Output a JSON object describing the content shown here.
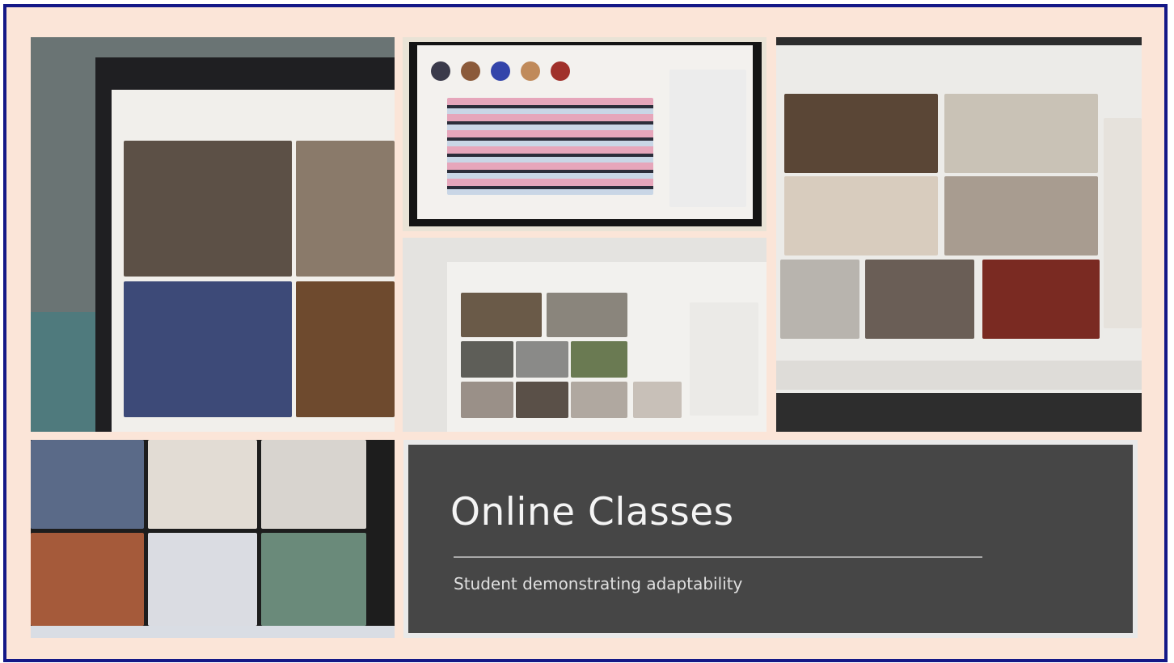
{
  "slide": {
    "title": "Online Classes",
    "subtitle": "Student demonstrating adaptability"
  },
  "colors": {
    "frame_border": "#141887",
    "frame_background": "#fbe5d8",
    "slide_background": "#464646",
    "slide_text": "#f4f4f4"
  },
  "photos": [
    {
      "name": "laptop-video-call-grid-four"
    },
    {
      "name": "classroom-call-with-pattern-slide"
    },
    {
      "name": "video-call-grid-eight"
    },
    {
      "name": "video-call-grid-ten"
    },
    {
      "name": "video-call-grid-six"
    }
  ]
}
